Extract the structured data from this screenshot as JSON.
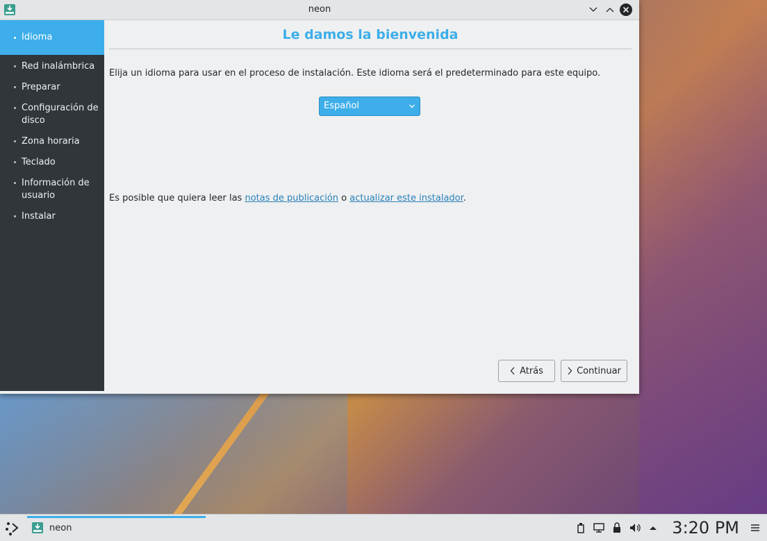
{
  "window": {
    "title": "neon"
  },
  "sidebar": {
    "steps": [
      "Idioma",
      "Red inalámbrica",
      "Preparar",
      "Configuración de disco",
      "Zona horaria",
      "Teclado",
      "Información de usuario",
      "Instalar"
    ],
    "active_index": 0
  },
  "content": {
    "heading": "Le damos la bienvenida",
    "intro": "Elija un idioma para usar en el proceso de instalación. Este idioma será el predeterminado para este equipo.",
    "language_select": {
      "value": "Español"
    },
    "notes": {
      "prefix": "Es posible que quiera leer las ",
      "link1": "notas de publicación",
      "middle": " o ",
      "link2": "actualizar este instalador",
      "suffix": "."
    }
  },
  "buttons": {
    "back": "Atrás",
    "continue": "Continuar"
  },
  "taskbar": {
    "task_label": "neon",
    "clock": "3:20 PM"
  },
  "colors": {
    "accent": "#3daee9",
    "sidebar": "#31363b",
    "link": "#2980b9"
  },
  "icons": [
    "installer-icon",
    "minimize-icon",
    "maximize-icon",
    "close-icon",
    "chevron-down-icon",
    "chevron-left-icon",
    "chevron-right-icon",
    "launcher-icon",
    "usb-icon",
    "network-icon",
    "lock-icon",
    "volume-icon",
    "tray-expand-icon",
    "menu-icon"
  ]
}
